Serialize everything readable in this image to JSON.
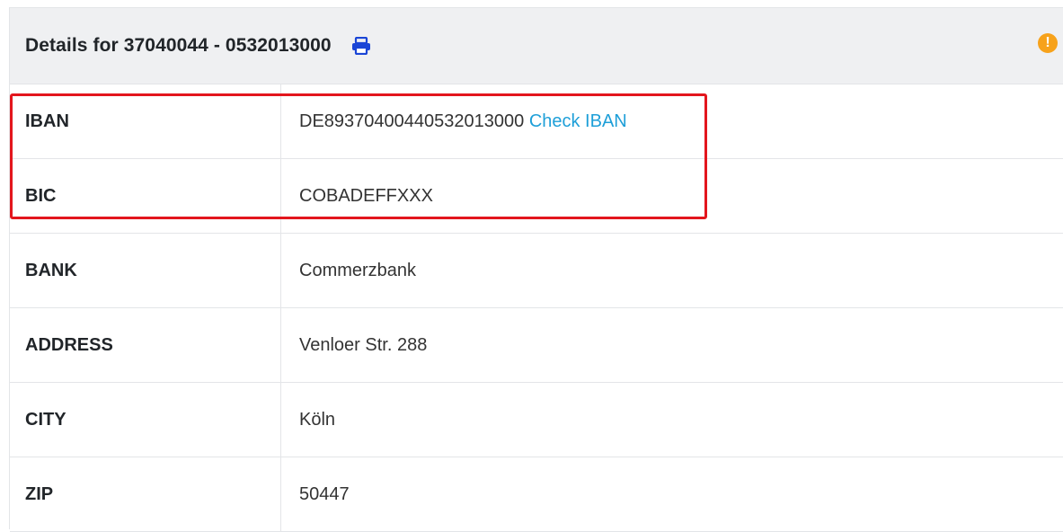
{
  "header": {
    "title": "Details for 37040044 - 0532013000",
    "print_icon": "print-icon",
    "warning_icon": "exclamation-icon",
    "warning_glyph": "!",
    "print_color": "#1a45d6",
    "warning_color": "#f7a21b"
  },
  "rows": [
    {
      "label": "IBAN",
      "value": "DE89370400440532013000",
      "link": "Check IBAN"
    },
    {
      "label": "BIC",
      "value": "COBADEFFXXX"
    },
    {
      "label": "BANK",
      "value": "Commerzbank"
    },
    {
      "label": "ADDRESS",
      "value": "Venloer Str. 288"
    },
    {
      "label": "CITY",
      "value": "Köln"
    },
    {
      "label": "ZIP",
      "value": "50447"
    }
  ],
  "highlight": {
    "color": "#e3161d",
    "covers_rows": [
      "IBAN",
      "BIC"
    ]
  },
  "link_color": "#1e9fd8"
}
